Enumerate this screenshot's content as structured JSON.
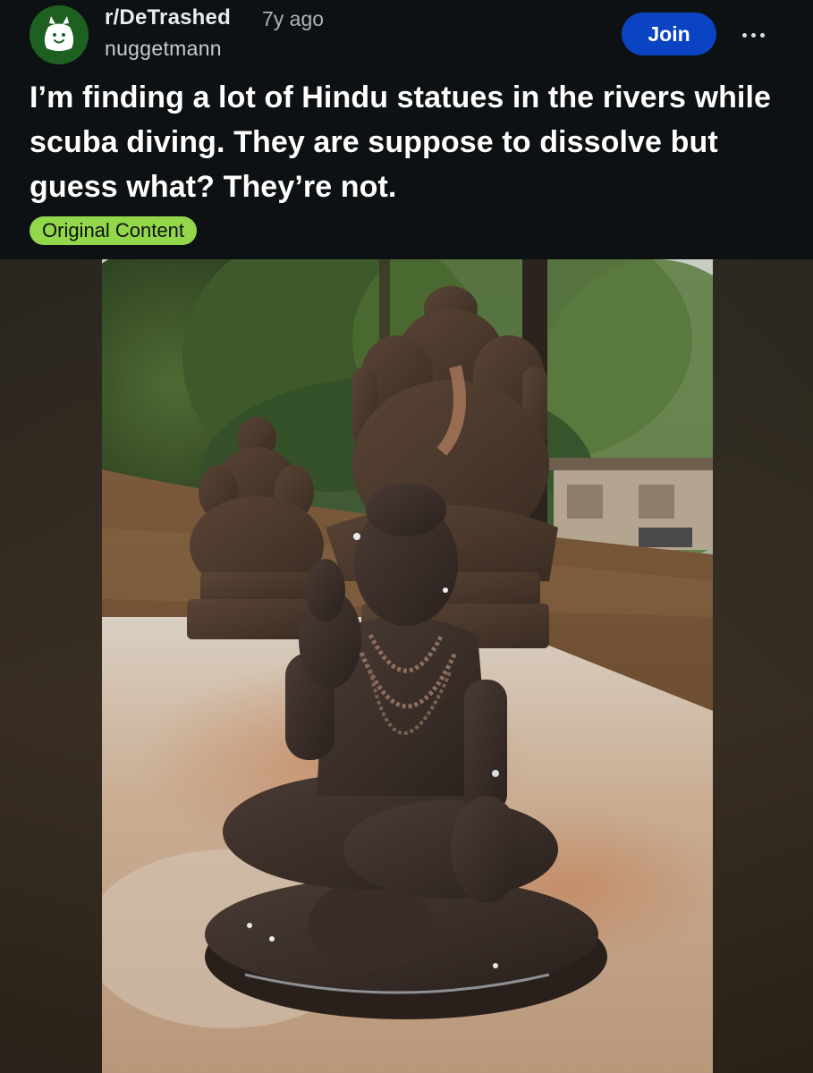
{
  "post": {
    "subreddit": "r/DeTrashed",
    "age": "7y ago",
    "author": "nuggetmann",
    "join_label": "Join",
    "title": "I’m finding a lot of Hindu statues in the rivers while scuba diving. They are suppose to dissolve but guess what? They’re not.",
    "flair": "Original Content"
  },
  "icons": {
    "avatar": "trash-bag-avatar-icon",
    "more": "more-options-icon"
  },
  "colors": {
    "background": "#0e1113",
    "join_button": "#0a44c2",
    "flair": "#92d84a"
  }
}
